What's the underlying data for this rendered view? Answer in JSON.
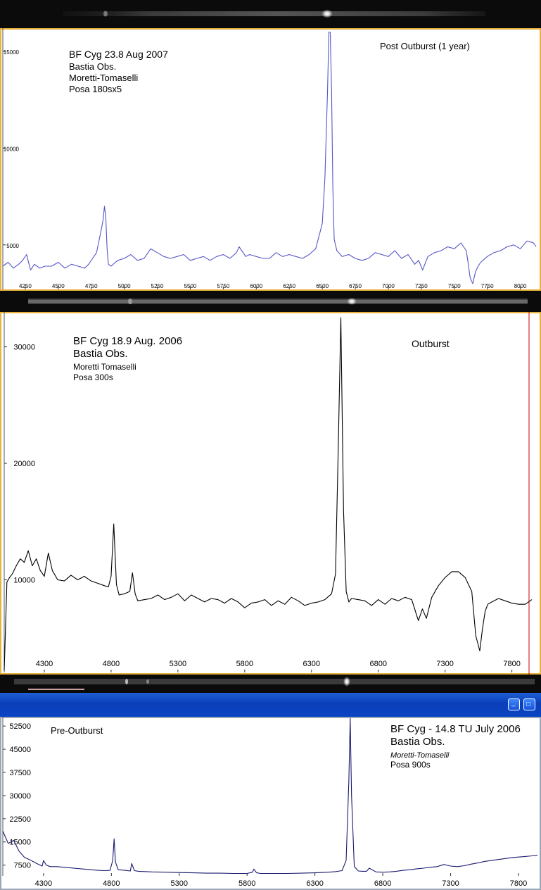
{
  "chart_data": [
    {
      "type": "line",
      "title": "Post Outburst (1 year)",
      "annotation": [
        "BF Cyg 23.8 Aug 2007",
        "Bastia Obs.",
        "Moretti-Tomaselli",
        "Posa 180sx5"
      ],
      "xlabel": "",
      "ylabel": "",
      "xlim": [
        4080,
        8130
      ],
      "ylim": [
        2700,
        16200
      ],
      "x_ticks": [
        4250,
        4500,
        4750,
        5000,
        5250,
        5500,
        5750,
        6000,
        6250,
        6500,
        6750,
        7000,
        7250,
        7500,
        7750,
        8000
      ],
      "y_ticks": [
        5000,
        10000,
        15000
      ],
      "grid": false,
      "line_color": "#5555c8",
      "series": [
        {
          "x": [
            4080,
            4120,
            4160,
            4200,
            4230,
            4260,
            4290,
            4320,
            4360,
            4400,
            4450,
            4500,
            4550,
            4600,
            4650,
            4700,
            4730,
            4760,
            4790,
            4820,
            4840,
            4850,
            4860,
            4870,
            4880,
            4900,
            4950,
            5000,
            5050,
            5100,
            5150,
            5200,
            5250,
            5300,
            5350,
            5400,
            5450,
            5500,
            5550,
            5600,
            5650,
            5700,
            5750,
            5800,
            5850,
            5870,
            5890,
            5920,
            5950,
            6000,
            6050,
            6100,
            6150,
            6200,
            6250,
            6300,
            6350,
            6400,
            6450,
            6500,
            6520,
            6540,
            6550,
            6560,
            6570,
            6580,
            6590,
            6610,
            6650,
            6700,
            6750,
            6800,
            6850,
            6900,
            6950,
            7000,
            7050,
            7100,
            7150,
            7200,
            7230,
            7260,
            7300,
            7350,
            7400,
            7450,
            7500,
            7550,
            7590,
            7600,
            7620,
            7640,
            7660,
            7680,
            7700,
            7750,
            7800,
            7850,
            7900,
            7950,
            8000,
            8050,
            8100,
            8120
          ],
          "values": [
            3900,
            4100,
            3800,
            4000,
            4200,
            4500,
            3700,
            4000,
            3800,
            3900,
            3900,
            4100,
            3800,
            4000,
            3900,
            3800,
            4000,
            4300,
            4600,
            5600,
            6300,
            7000,
            6400,
            4800,
            4000,
            3900,
            4200,
            4300,
            4500,
            4200,
            4300,
            4800,
            4600,
            4400,
            4300,
            4400,
            4500,
            4200,
            4300,
            4400,
            4200,
            4400,
            4500,
            4300,
            4600,
            4900,
            4700,
            4400,
            4500,
            4400,
            4300,
            4300,
            4600,
            4400,
            4500,
            4400,
            4300,
            4500,
            4800,
            6100,
            8500,
            13000,
            16000,
            16000,
            13000,
            8000,
            5300,
            4700,
            4400,
            4500,
            4300,
            4200,
            4300,
            4600,
            4500,
            4400,
            4700,
            4300,
            4500,
            4000,
            4200,
            3700,
            4400,
            4600,
            4700,
            4900,
            4800,
            5100,
            4700,
            4300,
            3300,
            3000,
            3600,
            3900,
            4100,
            4400,
            4600,
            4700,
            4900,
            5000,
            4800,
            5200,
            5100,
            4900
          ]
        }
      ]
    },
    {
      "type": "line",
      "title": "Outburst",
      "annotation": [
        "BF Cyg 18.9 Aug. 2006",
        "Bastia Obs.",
        "Moretti Tomaselli",
        "Posa 300s"
      ],
      "xlabel": "",
      "ylabel": "",
      "xlim": [
        4000,
        7960
      ],
      "ylim": [
        2050,
        33000
      ],
      "x_ticks": [
        4300,
        4800,
        5300,
        5800,
        6300,
        6800,
        7300,
        7800
      ],
      "y_ticks": [
        10000,
        20000,
        30000
      ],
      "grid": false,
      "line_color": "#000000",
      "series": [
        {
          "x": [
            4000,
            4020,
            4040,
            4060,
            4090,
            4120,
            4150,
            4180,
            4210,
            4240,
            4270,
            4300,
            4330,
            4360,
            4400,
            4450,
            4500,
            4550,
            4600,
            4650,
            4700,
            4750,
            4780,
            4800,
            4820,
            4840,
            4860,
            4900,
            4940,
            4960,
            4980,
            5000,
            5050,
            5100,
            5150,
            5200,
            5250,
            5300,
            5350,
            5400,
            5450,
            5500,
            5550,
            5600,
            5650,
            5700,
            5750,
            5800,
            5850,
            5900,
            5950,
            6000,
            6050,
            6100,
            6150,
            6200,
            6250,
            6300,
            6350,
            6400,
            6450,
            6480,
            6500,
            6520,
            6540,
            6560,
            6580,
            6600,
            6650,
            6700,
            6750,
            6800,
            6850,
            6900,
            6950,
            7000,
            7050,
            7100,
            7130,
            7160,
            7200,
            7250,
            7300,
            7350,
            7400,
            7450,
            7500,
            7530,
            7560,
            7580,
            7600,
            7620,
            7650,
            7700,
            7750,
            7800,
            7850,
            7900,
            7950
          ],
          "values": [
            2200,
            9800,
            10200,
            10500,
            11200,
            11800,
            11500,
            12500,
            11200,
            11800,
            10800,
            10300,
            12300,
            10800,
            10000,
            9900,
            10400,
            10000,
            10300,
            9900,
            9700,
            9500,
            9400,
            10300,
            14800,
            9600,
            8700,
            8800,
            9000,
            10600,
            8800,
            8200,
            8300,
            8400,
            8700,
            8300,
            8500,
            8800,
            8200,
            8700,
            8400,
            8100,
            8400,
            8300,
            8000,
            8400,
            8100,
            7600,
            8000,
            8100,
            8300,
            7800,
            8200,
            7900,
            8500,
            8200,
            7800,
            8000,
            8100,
            8300,
            8800,
            10500,
            21000,
            32500,
            16000,
            9000,
            8100,
            8400,
            8300,
            8200,
            7800,
            8300,
            7900,
            8400,
            8200,
            8500,
            8300,
            6500,
            7500,
            6700,
            8500,
            9500,
            10200,
            10700,
            10700,
            10200,
            9000,
            5200,
            3900,
            5800,
            7300,
            7900,
            8100,
            8400,
            8200,
            8000,
            7900,
            7900,
            8300
          ]
        }
      ]
    },
    {
      "type": "line",
      "title": "Pre-Outburst",
      "annotation": [
        "BF Cyg - 14.8 TU July 2006",
        "Bastia Obs.",
        "Moretti-Tomaselli",
        "Posa 900s"
      ],
      "xlabel": "",
      "ylabel": "",
      "xlim": [
        4000,
        7940
      ],
      "ylim": [
        4000,
        55500
      ],
      "x_ticks": [
        4300,
        4800,
        5300,
        5800,
        6300,
        6800,
        7300,
        7800
      ],
      "y_ticks": [
        7500,
        15000,
        22500,
        30000,
        37500,
        45000,
        52500
      ],
      "grid": false,
      "line_color": "#1a1a6e",
      "series": [
        {
          "x": [
            4000,
            4040,
            4080,
            4120,
            4160,
            4200,
            4250,
            4290,
            4300,
            4320,
            4350,
            4400,
            4450,
            4500,
            4550,
            4600,
            4650,
            4700,
            4750,
            4790,
            4810,
            4820,
            4830,
            4850,
            4900,
            4940,
            4950,
            4970,
            5000,
            5100,
            5200,
            5300,
            5400,
            5500,
            5600,
            5700,
            5800,
            5840,
            5850,
            5870,
            5900,
            6000,
            6100,
            6200,
            6300,
            6400,
            6450,
            6500,
            6530,
            6550,
            6560,
            6570,
            6590,
            6620,
            6650,
            6680,
            6700,
            6750,
            6800,
            6850,
            6900,
            6950,
            7000,
            7050,
            7100,
            7150,
            7200,
            7250,
            7300,
            7350,
            7400,
            7450,
            7500,
            7530,
            7550,
            7600,
            7650,
            7700,
            7750,
            7800,
            7850,
            7900,
            7940
          ],
          "values": [
            18500,
            14500,
            15500,
            12000,
            10000,
            9200,
            8000,
            7200,
            9000,
            7500,
            7000,
            7000,
            6800,
            6600,
            6400,
            6200,
            6000,
            5800,
            5700,
            5800,
            9000,
            16000,
            8500,
            6000,
            5800,
            5600,
            8000,
            5700,
            5500,
            5300,
            5200,
            5100,
            5000,
            4900,
            4900,
            4800,
            4800,
            5200,
            6200,
            5000,
            4800,
            4800,
            4800,
            4900,
            5000,
            5200,
            5400,
            5700,
            9000,
            35000,
            55000,
            30000,
            7000,
            5600,
            5500,
            5500,
            6500,
            5300,
            5200,
            5300,
            5500,
            5800,
            6000,
            6300,
            6500,
            6800,
            7000,
            7700,
            7200,
            7000,
            7300,
            7800,
            8200,
            8500,
            8700,
            9000,
            9300,
            9600,
            9900,
            10100,
            10300,
            10500,
            10700
          ]
        }
      ]
    }
  ],
  "window": {
    "minimize_glyph": "_",
    "maximize_glyph": "□"
  }
}
